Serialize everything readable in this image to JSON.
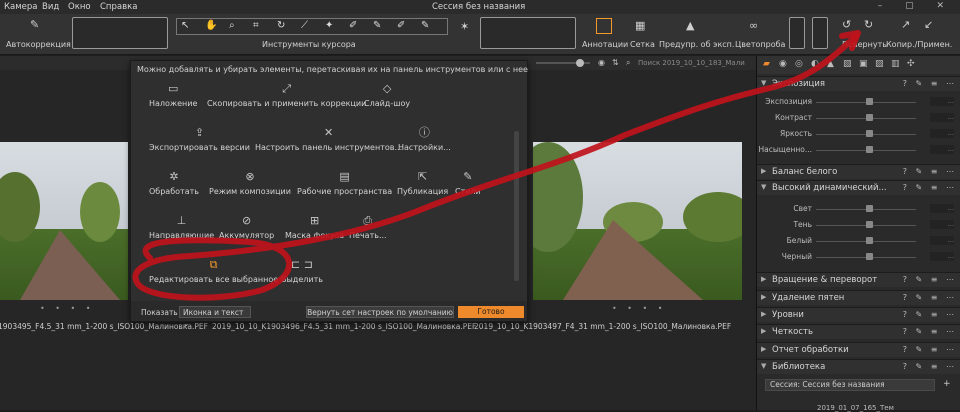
{
  "menu": [
    "Камера",
    "Вид",
    "Окно",
    "Справка"
  ],
  "window_title": "Сессия без названия",
  "toolbar": {
    "autocorrect": "Автокоррекция",
    "cursor_tools": "Инструменты курсора",
    "annotations": "Аннотации",
    "grid": "Сетка",
    "exposure_warning": "Предупр. об эксп.",
    "proof": "Цветопроба",
    "revert": "Повернуть",
    "copy_apply": "Копир./Примен."
  },
  "search_placeholder": "Поиск 2019_10_10_183_Мали",
  "popup": {
    "hint": "Можно добавлять и убирать элементы, перетаскивая их на панель инструментов или с нее",
    "tools": [
      [
        "Наложение",
        "Скопировать и применить коррекции",
        "Слайд-шоу"
      ],
      [
        "Экспортировать версии",
        "Настроить панель инструментов...",
        "Настройки..."
      ],
      [
        "Обработать",
        "Режим композиции",
        "Рабочие пространства",
        "Публикация",
        "Стили"
      ],
      [
        "Направляющие",
        "Аккумулятор",
        "Маска фокуса",
        "Печать..."
      ],
      [
        "Редактировать все выбранное",
        "Выделить"
      ]
    ],
    "show_label": "Показать",
    "show_value": "Иконка и текст",
    "default_button": "Вернуть сет настроек по умолчанию",
    "done_button": "Готово"
  },
  "filenames": [
    "1903495_F4.5_31 mm_1-200 s_ISO100_Малиновка.PEF",
    "2019_10_10_K1903496_F4.5_31 mm_1-200 s_ISO100_Малиновка.PEF",
    "2019_10_10_K1903497_F4_31 mm_1-200 s_ISO100_Малиновка.PEF"
  ],
  "panel": {
    "exposure": {
      "title": "Экспозиция",
      "sliders": [
        "Экспозиция",
        "Контраст",
        "Яркость",
        "Насыщенно..."
      ]
    },
    "white_balance": "Баланс белого",
    "hdr": {
      "title": "Высокий динамический...",
      "sliders": [
        "Свет",
        "Тень",
        "Белый",
        "Черный"
      ]
    },
    "sections": [
      "Вращение & переворот",
      "Удаление пятен",
      "Уровни",
      "Четкость",
      "Отчет обработки",
      "Библиотека"
    ],
    "session": "Сессия: Сессия без названия",
    "last_item": "2019_01_07_165_Тем"
  },
  "colors": {
    "accent": "#ee8a2b",
    "annotation": "#c0121b"
  }
}
